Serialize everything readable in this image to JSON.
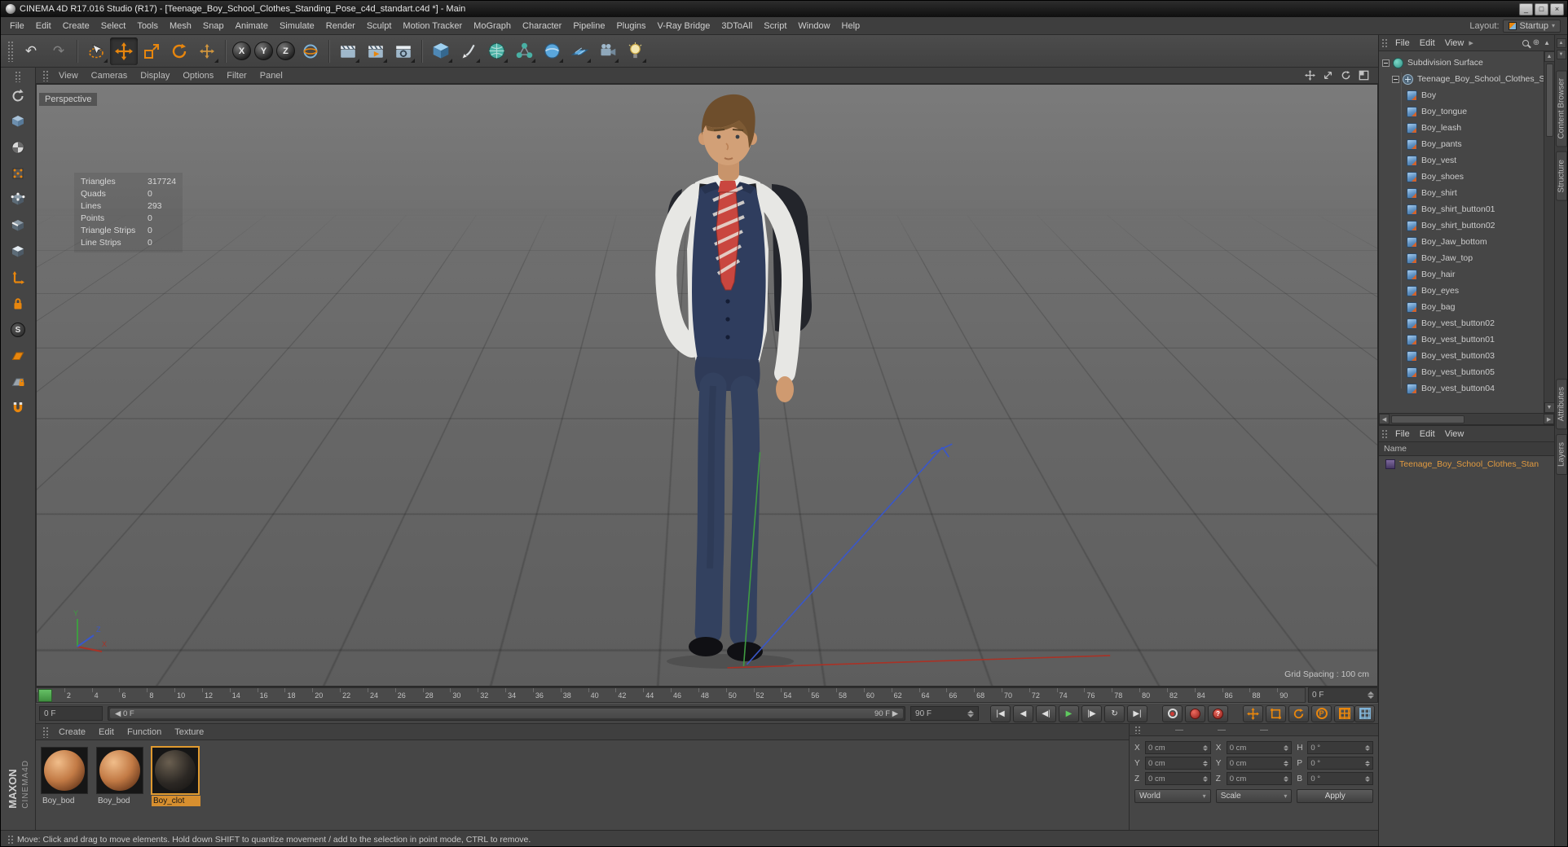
{
  "window": {
    "title": "CINEMA 4D R17.016 Studio (R17) - [Teenage_Boy_School_Clothes_Standing_Pose_c4d_standart.c4d *] - Main"
  },
  "icons": {
    "minimize": "_",
    "maximize": "□",
    "close": "×",
    "undo": "↶",
    "redo": "↷",
    "menu_arrow": "▸",
    "goto_start": "|◀",
    "prev_key": "◀",
    "prev_frame": "◀|",
    "play": "▶",
    "next_frame": "|▶",
    "loop": "↻",
    "goto_end": "▶|",
    "parameter": "P",
    "question": "?",
    "snap": "S",
    "scroll_up": "▲",
    "scroll_down": "▼",
    "scroll_left": "◀",
    "scroll_right": "▶",
    "range_left": "◀",
    "range_right": "▶"
  },
  "menubar": {
    "items": [
      "File",
      "Edit",
      "Create",
      "Select",
      "Tools",
      "Mesh",
      "Snap",
      "Animate",
      "Simulate",
      "Render",
      "Sculpt",
      "Motion Tracker",
      "MoGraph",
      "Character",
      "Pipeline",
      "Plugins",
      "V-Ray Bridge",
      "3DToAll",
      "Script",
      "Window",
      "Help"
    ],
    "layout_label": "Layout:",
    "layout_value": "Startup"
  },
  "toolbar": {
    "axis_labels": [
      "X",
      "Y",
      "Z"
    ]
  },
  "viewport": {
    "menu": [
      "View",
      "Cameras",
      "Display",
      "Options",
      "Filter",
      "Panel"
    ],
    "label": "Perspective",
    "grid_spacing": "Grid Spacing : 100 cm",
    "gizmo": [
      "X",
      "Y",
      "Z"
    ],
    "stats": [
      {
        "label": "Triangles",
        "value": "317724"
      },
      {
        "label": "Quads",
        "value": "0"
      },
      {
        "label": "Lines",
        "value": "293"
      },
      {
        "label": "Points",
        "value": "0"
      },
      {
        "label": "Triangle Strips",
        "value": "0"
      },
      {
        "label": "Line Strips",
        "value": "0"
      }
    ]
  },
  "timeline": {
    "ticks": [
      "0",
      "2",
      "4",
      "6",
      "8",
      "10",
      "12",
      "14",
      "16",
      "18",
      "20",
      "22",
      "24",
      "26",
      "28",
      "30",
      "32",
      "34",
      "36",
      "38",
      "40",
      "42",
      "44",
      "46",
      "48",
      "50",
      "52",
      "54",
      "56",
      "58",
      "60",
      "62",
      "64",
      "66",
      "68",
      "70",
      "72",
      "74",
      "76",
      "78",
      "80",
      "82",
      "84",
      "86",
      "88",
      "90"
    ],
    "current": "0 F",
    "range_start": "0 F",
    "range_end": "90 F",
    "end": "90 F"
  },
  "materials": {
    "menu": [
      "Create",
      "Edit",
      "Function",
      "Texture"
    ],
    "items": [
      {
        "name": "Boy_bod",
        "kind": "skin",
        "selected": false
      },
      {
        "name": "Boy_bod",
        "kind": "skin",
        "selected": false
      },
      {
        "name": "Boy_clot",
        "kind": "dark",
        "selected": true
      }
    ]
  },
  "coordinates": {
    "dashes": [
      "—",
      "—",
      "—"
    ],
    "groups": [
      {
        "rows": [
          {
            "label": "X",
            "value": "0 cm"
          },
          {
            "label": "Y",
            "value": "0 cm"
          },
          {
            "label": "Z",
            "value": "0 cm"
          }
        ],
        "footer": "World"
      },
      {
        "rows": [
          {
            "label": "X",
            "value": "0 cm"
          },
          {
            "label": "Y",
            "value": "0 cm"
          },
          {
            "label": "Z",
            "value": "0 cm"
          }
        ],
        "footer": "Scale"
      },
      {
        "rows": [
          {
            "label": "H",
            "value": "0 °"
          },
          {
            "label": "P",
            "value": "0 °"
          },
          {
            "label": "B",
            "value": "0 °"
          }
        ],
        "footer": "Apply"
      }
    ]
  },
  "status_bar": {
    "text": "Move: Click and drag to move elements. Hold down SHIFT to quantize movement / add to the selection in point mode, CTRL to remove."
  },
  "object_manager": {
    "menu": [
      "File",
      "Edit",
      "View"
    ],
    "tree": [
      {
        "name": "Subdivision Surface",
        "depth": 0,
        "icon": "subdivision",
        "expander": true
      },
      {
        "name": "Teenage_Boy_School_Clothes_Sta",
        "depth": 1,
        "icon": "null",
        "expander": true
      },
      {
        "name": "Boy",
        "depth": 2,
        "icon": "polygon"
      },
      {
        "name": "Boy_tongue",
        "depth": 2,
        "icon": "polygon"
      },
      {
        "name": "Boy_leash",
        "depth": 2,
        "icon": "polygon"
      },
      {
        "name": "Boy_pants",
        "depth": 2,
        "icon": "polygon"
      },
      {
        "name": "Boy_vest",
        "depth": 2,
        "icon": "polygon"
      },
      {
        "name": "Boy_shoes",
        "depth": 2,
        "icon": "polygon"
      },
      {
        "name": "Boy_shirt",
        "depth": 2,
        "icon": "polygon"
      },
      {
        "name": "Boy_shirt_button01",
        "depth": 2,
        "icon": "polygon"
      },
      {
        "name": "Boy_shirt_button02",
        "depth": 2,
        "icon": "polygon"
      },
      {
        "name": "Boy_Jaw_bottom",
        "depth": 2,
        "icon": "polygon"
      },
      {
        "name": "Boy_Jaw_top",
        "depth": 2,
        "icon": "polygon"
      },
      {
        "name": "Boy_hair",
        "depth": 2,
        "icon": "polygon"
      },
      {
        "name": "Boy_eyes",
        "depth": 2,
        "icon": "polygon"
      },
      {
        "name": "Boy_bag",
        "depth": 2,
        "icon": "polygon"
      },
      {
        "name": "Boy_vest_button02",
        "depth": 2,
        "icon": "polygon"
      },
      {
        "name": "Boy_vest_button01",
        "depth": 2,
        "icon": "polygon"
      },
      {
        "name": "Boy_vest_button03",
        "depth": 2,
        "icon": "polygon"
      },
      {
        "name": "Boy_vest_button05",
        "depth": 2,
        "icon": "polygon"
      },
      {
        "name": "Boy_vest_button04",
        "depth": 2,
        "icon": "polygon"
      }
    ]
  },
  "layer_panel": {
    "menu": [
      "File",
      "Edit",
      "View"
    ],
    "name_header": "Name",
    "items": [
      {
        "name": "Teenage_Boy_School_Clothes_Stan"
      }
    ]
  },
  "side_tabs": {
    "upper": [
      "Content Browser",
      "Structure"
    ],
    "lower": [
      "Attributes",
      "Layers"
    ]
  },
  "branding": {
    "maxon": "MAXON",
    "cinema": "CINEMA4D"
  }
}
